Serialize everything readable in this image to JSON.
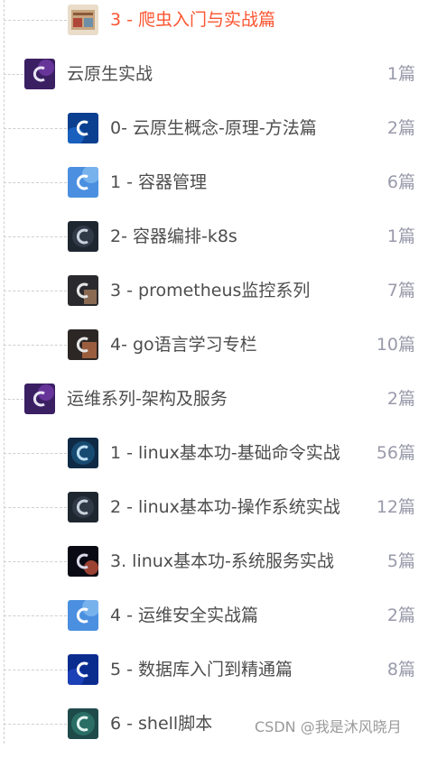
{
  "tree": {
    "items": [
      {
        "label": "3 - 爬虫入门与实战篇",
        "count": "",
        "level": 2,
        "active": true,
        "icon": "crawler-book-icon"
      },
      {
        "label": "云原生实战",
        "count": "1篇",
        "level": 1,
        "active": false,
        "icon": "column-cover-icon"
      },
      {
        "label": "0- 云原生概念-原理-方法篇",
        "count": "2篇",
        "level": 2,
        "active": false,
        "icon": "column-cover-icon"
      },
      {
        "label": "1 - 容器管理",
        "count": "6篇",
        "level": 2,
        "active": false,
        "icon": "column-cover-icon"
      },
      {
        "label": "2- 容器编排-k8s",
        "count": "1篇",
        "level": 2,
        "active": false,
        "icon": "column-cover-icon"
      },
      {
        "label": "3 - prometheus监控系列",
        "count": "7篇",
        "level": 2,
        "active": false,
        "icon": "column-cover-icon"
      },
      {
        "label": "4- go语言学习专栏",
        "count": "10篇",
        "level": 2,
        "active": false,
        "icon": "column-cover-icon"
      },
      {
        "label": "运维系列-架构及服务",
        "count": "2篇",
        "level": 1,
        "active": false,
        "icon": "column-cover-icon"
      },
      {
        "label": "1 - linux基本功-基础命令实战",
        "count": "56篇",
        "level": 2,
        "active": false,
        "icon": "column-cover-icon"
      },
      {
        "label": "2 - linux基本功-操作系统实战",
        "count": "12篇",
        "level": 2,
        "active": false,
        "icon": "column-cover-icon"
      },
      {
        "label": "3. linux基本功-系统服务实战",
        "count": "5篇",
        "level": 2,
        "active": false,
        "icon": "column-cover-icon"
      },
      {
        "label": "4 - 运维安全实战篇",
        "count": "2篇",
        "level": 2,
        "active": false,
        "icon": "column-cover-icon"
      },
      {
        "label": "5 - 数据库入门到精通篇",
        "count": "8篇",
        "level": 2,
        "active": false,
        "icon": "column-cover-icon"
      },
      {
        "label": "6 - shell脚本",
        "count": "",
        "level": 2,
        "active": false,
        "icon": "column-cover-icon"
      }
    ]
  },
  "watermark": "CSDN @我是沐风晓月",
  "colors": {
    "active_text": "#fc5531",
    "text": "#4d4d4d",
    "count": "#999aaa"
  }
}
